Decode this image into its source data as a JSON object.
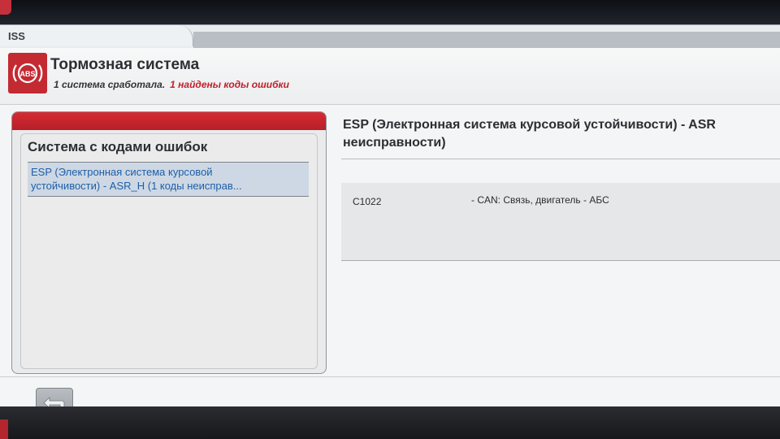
{
  "window": {
    "tab_title": "ISS"
  },
  "header": {
    "icon": "abs-icon",
    "icon_text": "ABS",
    "title": "Тормозная система",
    "status_text": "1 система сработала.",
    "error_text": "1 найдены коды ошибки"
  },
  "left_panel": {
    "heading": "Система с кодами ошибок",
    "items": [
      {
        "line1": "ESP (Электронная система курсовой",
        "line2": "устойчивости) - ASR_H (1 коды неисправ..."
      }
    ]
  },
  "right_panel": {
    "title_line1": "ESP (Электронная система курсовой устойчивости) - ASR",
    "title_line2": "неисправности)",
    "codes": [
      {
        "code": "C1022",
        "description": "- CAN: Связь, двигатель - АБС"
      }
    ]
  },
  "footer": {
    "back_icon": "back-arrow-icon"
  },
  "colors": {
    "accent_red": "#c32a32",
    "error_text": "#c0202c",
    "list_selected_bg": "#cdd8e4",
    "list_text": "#1f5ea8"
  }
}
